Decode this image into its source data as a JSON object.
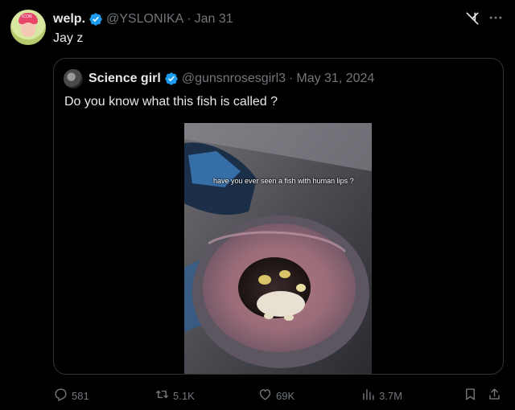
{
  "tweet": {
    "author_name": "welp.",
    "handle": "@YSLONIKA",
    "separator": "·",
    "date": "Jan 31",
    "text": "Jay z",
    "avatar_badge": "ICON"
  },
  "quoted": {
    "author_name": "Science girl",
    "handle": "@gunsnrosesgirl3",
    "separator": "·",
    "date": "May 31, 2024",
    "text": "Do you know what this fish is called ?",
    "media_caption": "have you ever seen a fish with human lips ?"
  },
  "actions": {
    "replies": "581",
    "reposts": "5.1K",
    "likes": "69K",
    "views": "3.7M"
  },
  "icons": {
    "grok": "grok-icon",
    "more": "more-icon",
    "reply": "reply-icon",
    "repost": "repost-icon",
    "like": "heart-icon",
    "views": "views-icon",
    "bookmark": "bookmark-icon",
    "share": "share-icon",
    "verified": "verified-badge-icon"
  },
  "colors": {
    "background": "#000000",
    "text": "#e7e9ea",
    "muted": "#71767b",
    "verified": "#1d9bf0",
    "border": "#2f3336"
  }
}
